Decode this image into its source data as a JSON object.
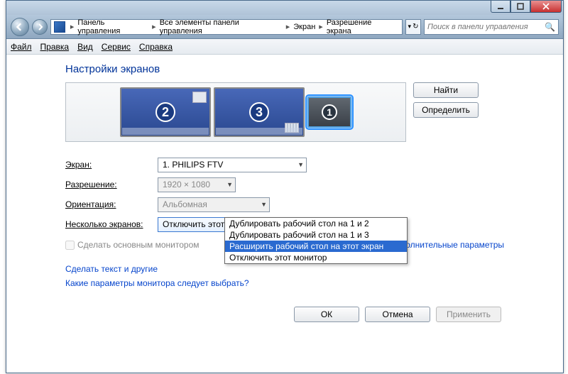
{
  "breadcrumbs": [
    "Панель управления",
    "Все элементы панели управления",
    "Экран",
    "Разрешение экрана"
  ],
  "search_placeholder": "Поиск в панели управления",
  "menus": {
    "file": "Файл",
    "edit": "Правка",
    "view": "Вид",
    "service": "Сервис",
    "help": "Справка"
  },
  "title": "Настройки экранов",
  "monitors": {
    "two": "2",
    "three": "3",
    "one": "1"
  },
  "side_buttons": {
    "find": "Найти",
    "identify": "Определить"
  },
  "labels": {
    "screen": "Экран:",
    "resolution": "Разрешение:",
    "orientation": "Ориентация:",
    "multiple": "Несколько экранов:",
    "make_main": "Сделать основным монитором",
    "advanced": "Дополнительные параметры"
  },
  "values": {
    "screen": "1. PHILIPS FTV",
    "resolution": "1920 × 1080",
    "orientation": "Альбомная",
    "multiple": "Отключить этот монитор"
  },
  "dropdown_options": [
    "Дублировать рабочий стол на 1 и 2",
    "Дублировать рабочий стол на 1 и 3",
    "Расширить рабочий стол на этот экран",
    "Отключить этот монитор"
  ],
  "links": {
    "text_size": "Сделать текст и другие",
    "which_monitor": "Какие параметры монитора следует выбрать?"
  },
  "buttons": {
    "ok": "ОК",
    "cancel": "Отмена",
    "apply": "Применить"
  }
}
